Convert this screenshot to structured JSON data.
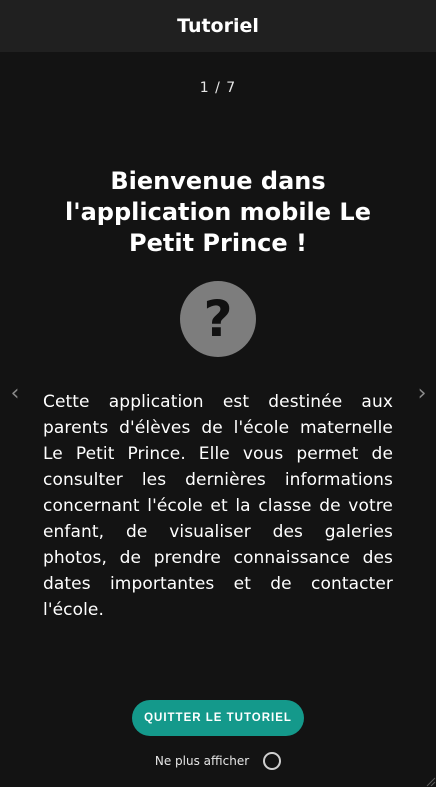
{
  "header": {
    "title": "Tutoriel"
  },
  "slide": {
    "counter": "1 / 7",
    "title": "Bienvenue dans l'application mobile Le Petit Prince !",
    "icon": "help-icon",
    "icon_glyph": "?",
    "text": "Cette application est destinée aux parents d'élèves de l'école maternelle Le Petit Prince. Elle vous permet de consulter les dernières informations concernant l'école et la classe de votre enfant, de visualiser des galeries photos, de prendre connaissance des dates importantes et de contacter l'école."
  },
  "nav": {
    "prev_glyph": "‹",
    "next_glyph": "›"
  },
  "footer": {
    "quit_label": "QUITTER LE TUTORIEL",
    "no_show_label": "Ne plus afficher"
  },
  "colors": {
    "background": "#131313",
    "header": "#202020",
    "accent": "#14998b",
    "icon_circle": "#7d7d7d"
  }
}
